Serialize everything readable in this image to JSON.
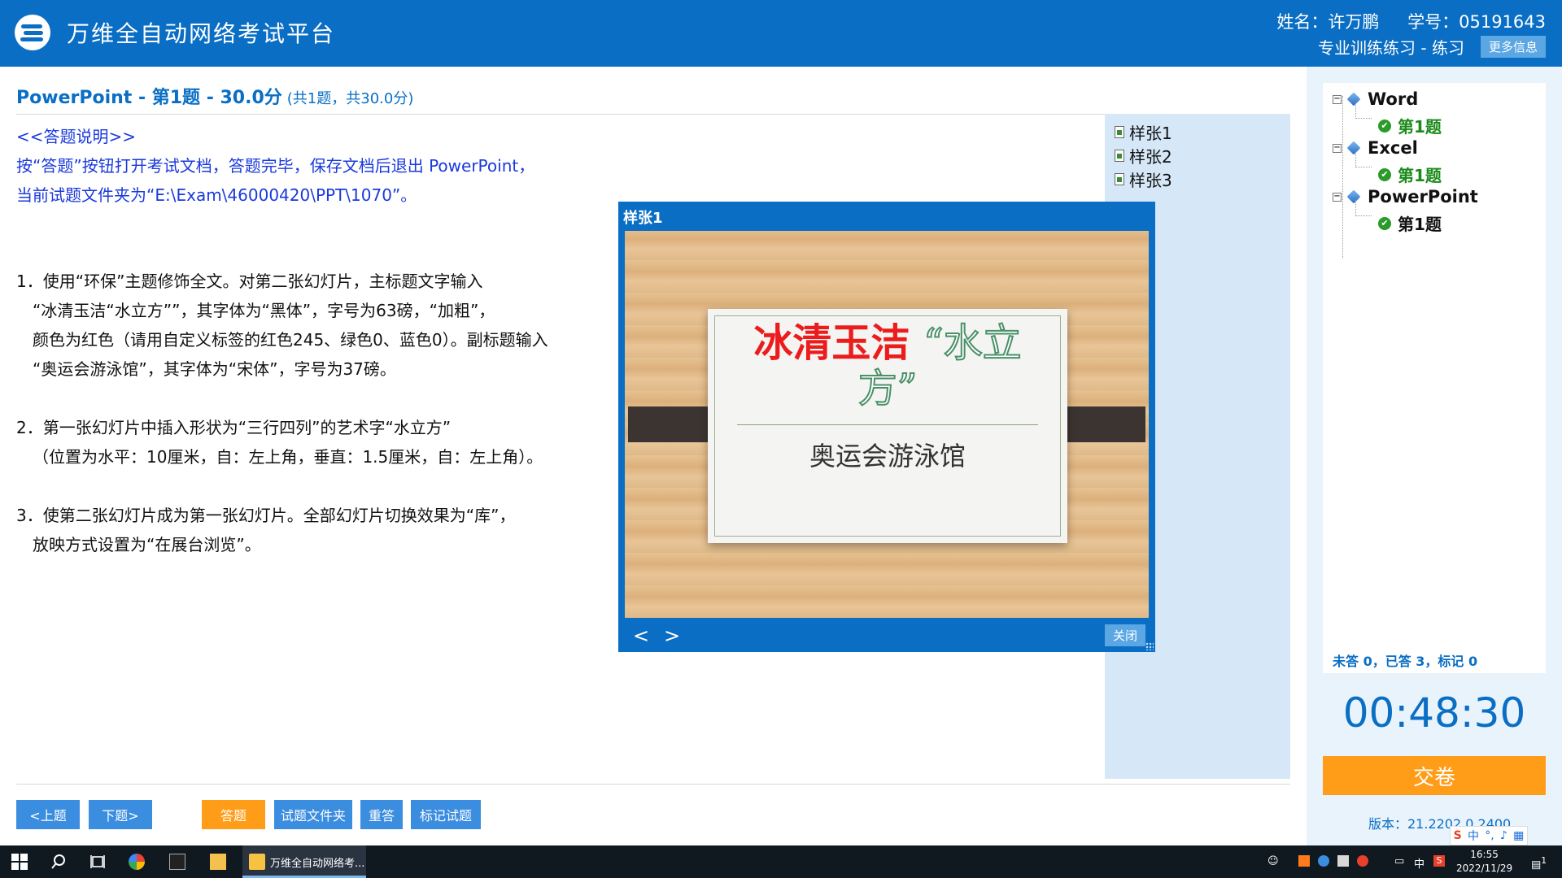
{
  "header": {
    "app_title": "万维全自动网络考试平台",
    "name_label": "姓名：许万鹏",
    "id_label": "学号：05191643",
    "mode_label": "专业训练练习 - 练习",
    "more_button": "更多信息"
  },
  "question": {
    "title": "PowerPoint - 第1题 - 30.0分",
    "subtitle": "(共1题，共30.0分)"
  },
  "instructions": {
    "heading": "<<答题说明>>",
    "line1": "按“答题”按钮打开考试文档，答题完毕，保存文档后退出 PowerPoint，",
    "line2": "当前试题文件夹为“E:\\Exam\\46000420\\PPT\\1070”。"
  },
  "tasks": [
    {
      "lines": [
        "1．使用“环保”主题修饰全文。对第二张幻灯片，主标题文字输入",
        "“冰清玉洁“水立方””，其字体为“黑体”，字号为63磅，“加粗”，",
        "颜色为红色（请用自定义标签的红色245、绿色0、蓝色0）。副标题输入",
        "“奥运会游泳馆”，其字体为“宋体”，字号为37磅。"
      ]
    },
    {
      "lines": [
        "2．第一张幻灯片中插入形状为“三行四列”的艺术字“水立方”",
        "（位置为水平：10厘米，自：左上角，垂直：1.5厘米，自：左上角）。"
      ]
    },
    {
      "lines": [
        "3．使第二张幻灯片成为第一张幻灯片。全部幻灯片切换效果为“库”，",
        "放映方式设置为“在展台浏览”。"
      ]
    }
  ],
  "samples": [
    "样张1",
    "样张2",
    "样张3"
  ],
  "preview": {
    "window_title": "样张1",
    "slide_title_red": "冰清玉洁",
    "slide_title_green_1": "“水立",
    "slide_title_green_2": "方”",
    "slide_subtitle": "奥运会游泳馆",
    "prev_arrow": "<",
    "next_arrow": ">",
    "close_button": "关闭"
  },
  "buttons": {
    "prev": "<上题",
    "next": "下题>",
    "answer": "答题",
    "folder": "试题文件夹",
    "redo": "重答",
    "mark": "标记试题"
  },
  "tree": [
    {
      "label": "Word",
      "child": "第1题",
      "child_done": true
    },
    {
      "label": "Excel",
      "child": "第1题",
      "child_done": true
    },
    {
      "label": "PowerPoint",
      "child": "第1题",
      "child_done": false
    }
  ],
  "status": {
    "stats": "未答 0，已答 3，标记 0",
    "timer": "00:48:30",
    "submit": "交卷",
    "version": "版本：21.2202.0.2400"
  },
  "taskbar": {
    "app_label": "万维全自动网络考...",
    "time": "16:55",
    "date": "2022/11/29",
    "ime": "中",
    "notification_count": "1"
  },
  "colors": {
    "brand_blue": "#0a6ec4",
    "accent_orange": "#ff9d19",
    "done_green": "#2a9a2a",
    "title_red": "#ec1c1c"
  }
}
